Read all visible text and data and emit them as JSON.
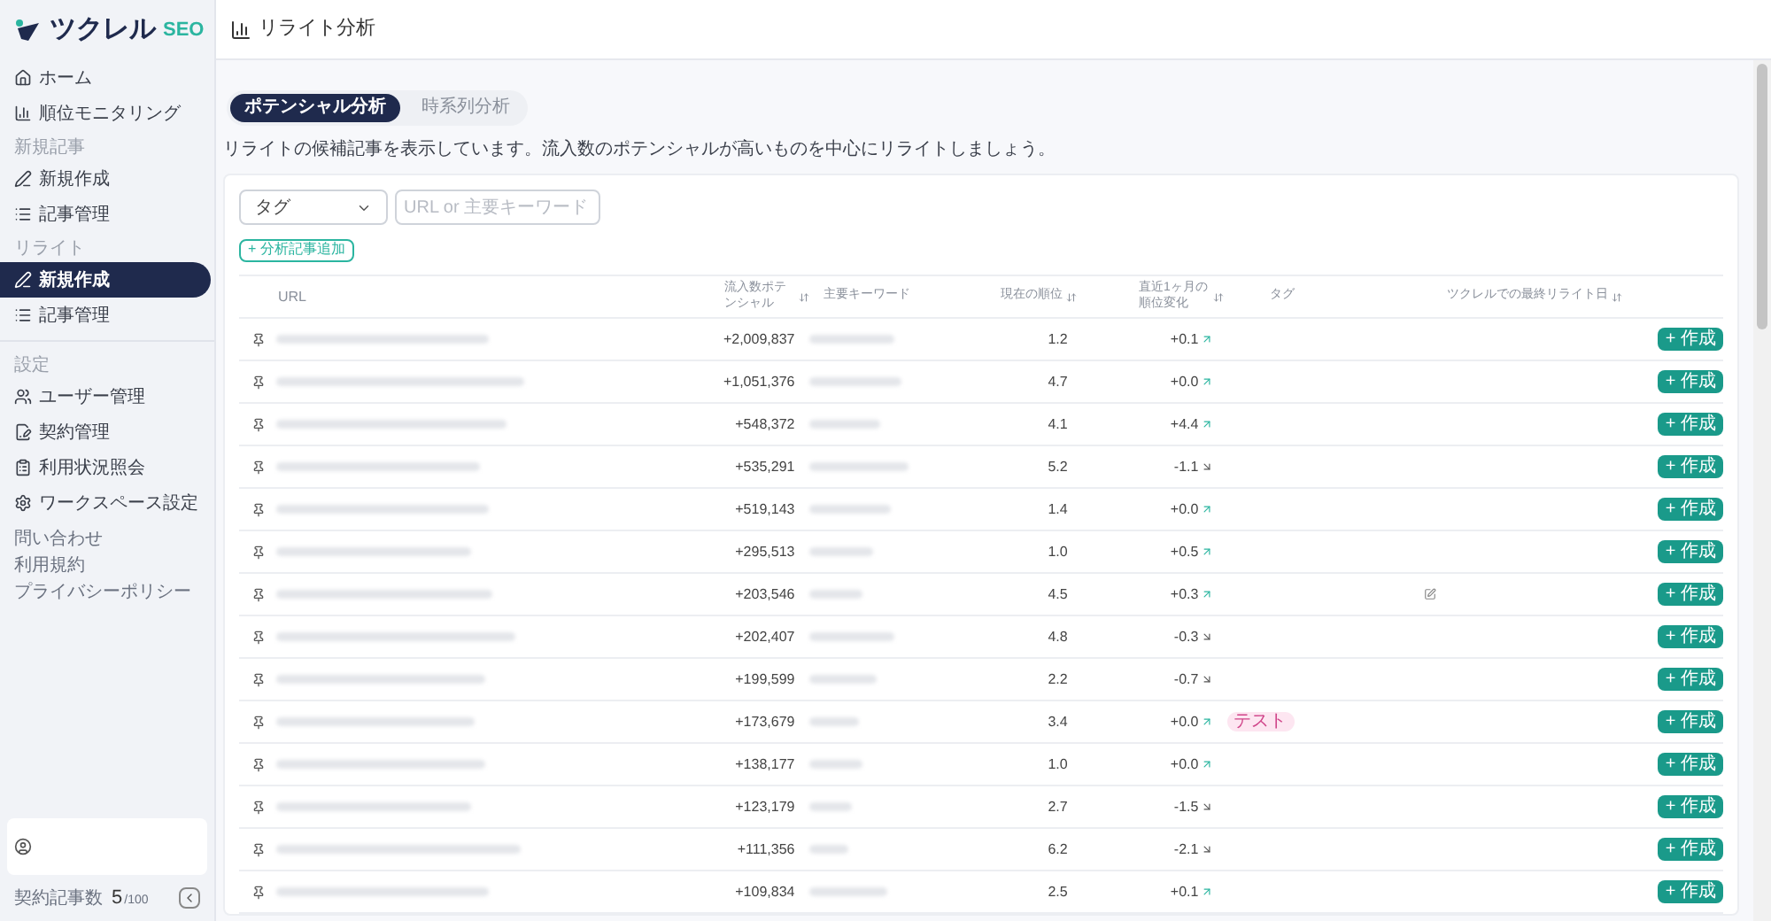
{
  "sidebar": {
    "logo": {
      "mark": "ツクレル",
      "suffix": "SEO"
    },
    "sections": [
      {
        "items": [
          {
            "label": "ホーム",
            "selected": false
          },
          {
            "label": "順位モニタリング",
            "selected": false
          }
        ]
      },
      {
        "title": "新規記事",
        "items": [
          {
            "label": "新規作成",
            "selected": false
          },
          {
            "label": "記事管理",
            "selected": false
          }
        ]
      },
      {
        "title": "リライト",
        "items": [
          {
            "label": "新規作成",
            "selected": true
          },
          {
            "label": "記事管理",
            "selected": false
          }
        ]
      },
      {
        "title": "設定",
        "items": [
          {
            "label": "ユーザー管理",
            "selected": false
          },
          {
            "label": "契約管理",
            "selected": false
          },
          {
            "label": "利用状況照会",
            "selected": false
          },
          {
            "label": "ワークスペース設定",
            "selected": false
          }
        ]
      }
    ],
    "links": [
      "問い合わせ",
      "利用規約",
      "プライバシーポリシー"
    ],
    "quota": {
      "label": "契約記事数",
      "count": "5",
      "total": "/100"
    }
  },
  "header": {
    "title": "リライト分析"
  },
  "tabs": [
    {
      "label": "ポテンシャル分析",
      "selected": true
    },
    {
      "label": "時系列分析",
      "selected": false
    }
  ],
  "description": "リライトの候補記事を表示しています。流入数のポテンシャルが高いものを中心にリライトしましょう。",
  "filters": {
    "tag_select": "タグ",
    "search": {
      "placeholder": "URL or 主要キーワード"
    },
    "add_button": "+ 分析記事追加"
  },
  "table": {
    "columns": [
      "URL",
      "流入数ポテンシャル",
      "主要キーワード",
      "現在の順位",
      "直近1ヶ月の順位変化",
      "タグ",
      "ツクレルでの最終リライト日"
    ],
    "rows": [
      {
        "potential": "+2,009,837",
        "rank": "1.2",
        "change": "+0.1",
        "kind": "up",
        "action": "+ 作成"
      },
      {
        "potential": "+1,051,376",
        "rank": "4.7",
        "change": "+0.0",
        "kind": "up",
        "action": "+ 作成"
      },
      {
        "potential": "+548,372",
        "rank": "4.1",
        "change": "+4.4",
        "kind": "up",
        "action": "+ 作成"
      },
      {
        "potential": "+535,291",
        "rank": "5.2",
        "change": "-1.1",
        "kind": "down",
        "action": "+ 作成"
      },
      {
        "potential": "+519,143",
        "rank": "1.4",
        "change": "+0.0",
        "kind": "up",
        "action": "+ 作成"
      },
      {
        "potential": "+295,513",
        "rank": "1.0",
        "change": "+0.5",
        "kind": "up",
        "action": "+ 作成"
      },
      {
        "potential": "+203,546",
        "rank": "4.5",
        "change": "+0.3",
        "kind": "up",
        "edited": true,
        "action": "+ 作成"
      },
      {
        "potential": "+202,407",
        "rank": "4.8",
        "change": "-0.3",
        "kind": "down",
        "action": "+ 作成"
      },
      {
        "potential": "+199,599",
        "rank": "2.2",
        "change": "-0.7",
        "kind": "down",
        "action": "+ 作成"
      },
      {
        "potential": "+173,679",
        "rank": "3.4",
        "change": "+0.0",
        "kind": "up",
        "tag": "テスト",
        "action": "+ 作成"
      },
      {
        "potential": "+138,177",
        "rank": "1.0",
        "change": "+0.0",
        "kind": "up",
        "action": "+ 作成"
      },
      {
        "potential": "+123,179",
        "rank": "2.7",
        "change": "-1.5",
        "kind": "down",
        "action": "+ 作成"
      },
      {
        "potential": "+111,356",
        "rank": "6.2",
        "change": "-2.1",
        "kind": "down",
        "action": "+ 作成"
      },
      {
        "potential": "+109,834",
        "rank": "2.5",
        "change": "+0.1",
        "kind": "up",
        "action": "+ 作成"
      }
    ]
  }
}
